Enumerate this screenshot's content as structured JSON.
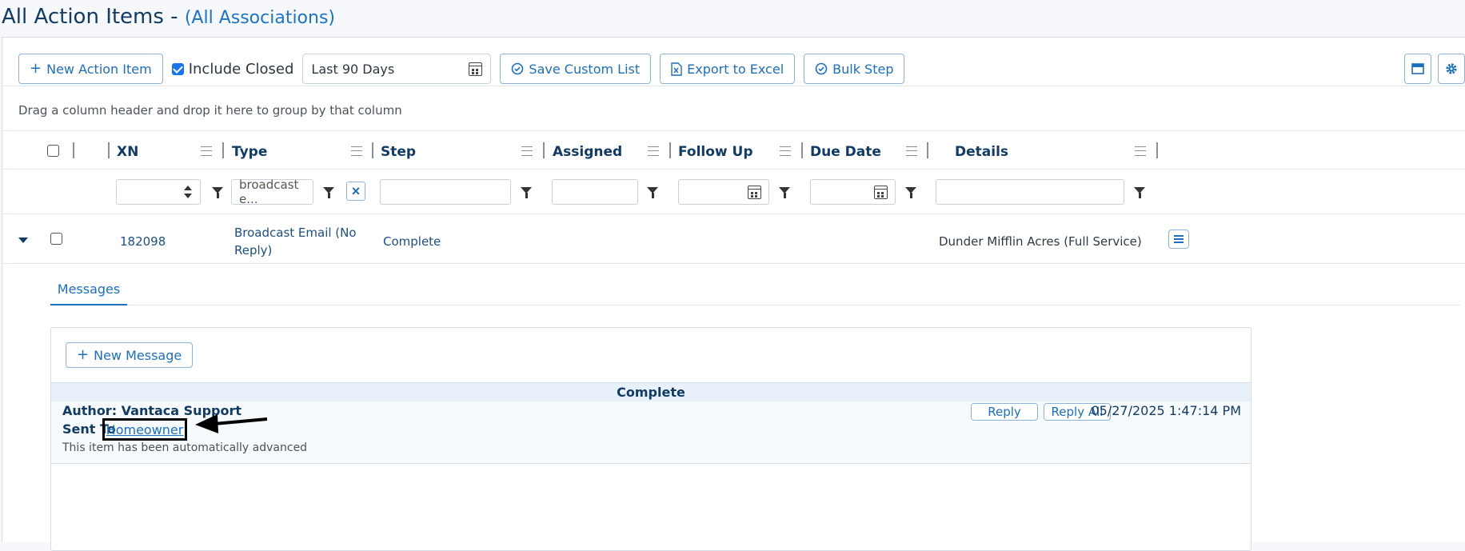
{
  "page": {
    "title": "All Action Items -",
    "association": "(All Associations)"
  },
  "toolbar": {
    "new_action_label": "New Action Item",
    "include_closed_label": "Include Closed",
    "include_closed_checked": true,
    "date_range": "Last 90 Days",
    "save_custom_label": "Save Custom List",
    "export_label": "Export to Excel",
    "bulk_step_label": "Bulk Step"
  },
  "grid": {
    "group_hint": "Drag a column header and drop it here to group by that column",
    "columns": [
      "XN",
      "Type",
      "Step",
      "Assigned",
      "Follow Up",
      "Due Date",
      "Details"
    ],
    "filters": {
      "type_value": "broadcast e..."
    },
    "rows": [
      {
        "xn": "182098",
        "type_line1": "Broadcast Email (No",
        "type_line2": "Reply)",
        "step": "Complete",
        "details": "Dunder Mifflin Acres (Full Service)"
      }
    ]
  },
  "detail": {
    "tab_label": "Messages",
    "new_message_label": "New Message",
    "status": "Complete",
    "message": {
      "author": "Author: Vantaca Support",
      "sent_to_label": "Sent To",
      "recipient": "Homeowner",
      "body": "This item has been automatically advanced",
      "reply_label": "Reply",
      "reply_all_label": "Reply All",
      "timestamp": "05/27/2025 1:47:14 PM"
    }
  },
  "colors": {
    "accent": "#1b6fbf",
    "heading": "#123b63",
    "checkbox": "#1a73e8"
  },
  "icons": [
    "plus-icon",
    "calendar-icon",
    "check-circle-icon",
    "excel-icon",
    "layout-icon",
    "gear-icon",
    "filter-icon",
    "sort-spinner-icon",
    "clear-filter-icon",
    "expand-caret-icon",
    "row-menu-icon",
    "annotation-arrow"
  ]
}
